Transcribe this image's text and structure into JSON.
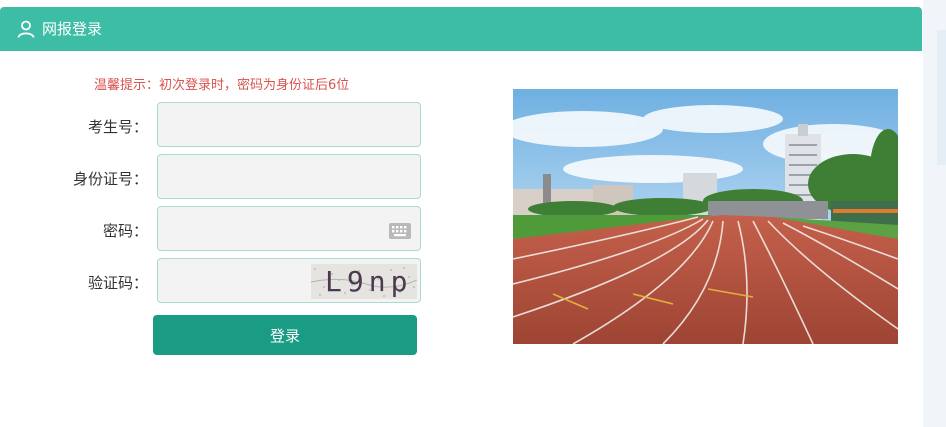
{
  "header": {
    "title": "网报登录",
    "icon": "user-icon"
  },
  "tip": "温馨提示：初次登录时，密码为身份证后6位",
  "form": {
    "exam_number_label": "考生号：",
    "id_number_label": "身份证号：",
    "password_label": "密码：",
    "captcha_label": "验证码：",
    "captcha_text": "L9np",
    "login_label": "登录"
  },
  "colors": {
    "header": "#3dbda5",
    "button": "#1a9c84",
    "tip": "#d9534f",
    "field_border": "#a8dccf",
    "track": "#b4523f",
    "grass": "#4f9b3a",
    "sky": "#8fc3ea"
  }
}
